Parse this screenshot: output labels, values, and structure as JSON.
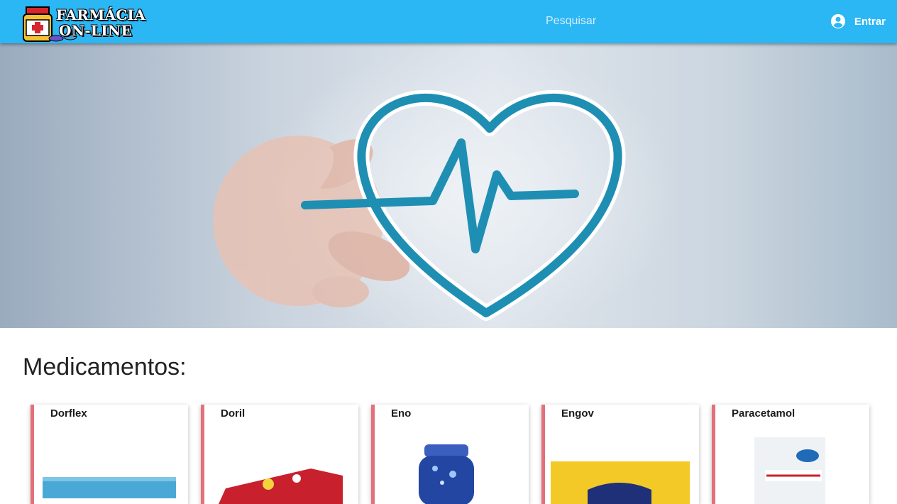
{
  "header": {
    "logo_line1": "FARMÁCIA",
    "logo_line2": "ON-LINE",
    "search_placeholder": "Pesquisar",
    "login_label": "Entrar",
    "login_icon": "account-circle-icon"
  },
  "main": {
    "section_title": "Medicamentos:",
    "products": [
      {
        "name": "Dorflex"
      },
      {
        "name": "Doril"
      },
      {
        "name": "Eno"
      },
      {
        "name": "Engov"
      },
      {
        "name": "Paracetamol"
      }
    ]
  },
  "colors": {
    "header_bg": "#2bb6f4",
    "card_accent": "#e3707a",
    "heart": "#1e8fb3"
  }
}
